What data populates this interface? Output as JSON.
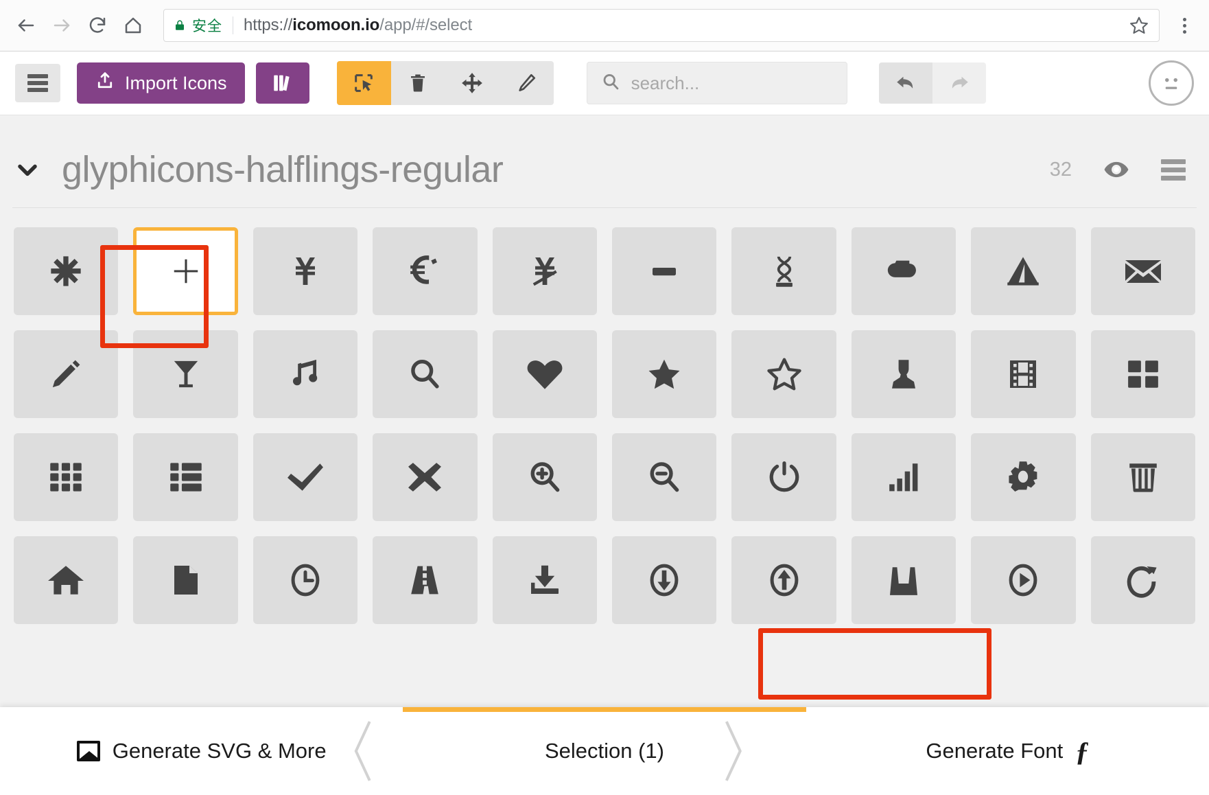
{
  "browser": {
    "security_label": "安全",
    "url_scheme": "https://",
    "url_host": "icomoon.io",
    "url_path": "/app/#/select",
    "icons": {
      "back": "back-arrow-icon",
      "forward": "forward-arrow-icon",
      "reload": "reload-icon",
      "home": "home-icon",
      "lock": "lock-icon",
      "bookmark": "star-icon",
      "menu": "three-dot-menu-icon"
    }
  },
  "toolbar": {
    "menu_label": "hamburger-menu",
    "import_label": "Import Icons",
    "library_label": "library",
    "tools": [
      {
        "name": "select-tool",
        "active": true
      },
      {
        "name": "delete-tool",
        "active": false
      },
      {
        "name": "move-tool",
        "active": false
      },
      {
        "name": "edit-tool",
        "active": false
      }
    ],
    "search_placeholder": "search...",
    "search_value": "",
    "undo_label": "undo",
    "redo_label": "redo",
    "avatar_label": "user-account"
  },
  "set": {
    "title": "glyphicons-halflings-regular",
    "count": "32",
    "collapsed": false
  },
  "grid": {
    "icons": [
      {
        "name": "asterisk-icon",
        "selected": false
      },
      {
        "name": "plus-icon",
        "selected": true
      },
      {
        "name": "yen-icon",
        "selected": false
      },
      {
        "name": "euro-icon",
        "selected": false
      },
      {
        "name": "ruble-icon",
        "selected": false
      },
      {
        "name": "minus-icon",
        "selected": false
      },
      {
        "name": "paperclip-icon",
        "selected": false
      },
      {
        "name": "cloud-icon",
        "selected": false
      },
      {
        "name": "tent-icon",
        "selected": false
      },
      {
        "name": "envelope-icon",
        "selected": false
      },
      {
        "name": "pencil-icon",
        "selected": false
      },
      {
        "name": "glass-icon",
        "selected": false
      },
      {
        "name": "music-icon",
        "selected": false
      },
      {
        "name": "search-icon",
        "selected": false
      },
      {
        "name": "heart-icon",
        "selected": false
      },
      {
        "name": "star-icon",
        "selected": false
      },
      {
        "name": "star-empty-icon",
        "selected": false
      },
      {
        "name": "user-icon",
        "selected": false
      },
      {
        "name": "film-icon",
        "selected": false
      },
      {
        "name": "th-large-icon",
        "selected": false
      },
      {
        "name": "th-grid-icon",
        "selected": false
      },
      {
        "name": "th-list-icon",
        "selected": false
      },
      {
        "name": "check-icon",
        "selected": false
      },
      {
        "name": "remove-icon",
        "selected": false
      },
      {
        "name": "zoom-in-icon",
        "selected": false
      },
      {
        "name": "zoom-out-icon",
        "selected": false
      },
      {
        "name": "power-off-icon",
        "selected": false
      },
      {
        "name": "signal-icon",
        "selected": false
      },
      {
        "name": "cog-icon",
        "selected": false
      },
      {
        "name": "trash-icon",
        "selected": false
      },
      {
        "name": "home-icon",
        "selected": false
      },
      {
        "name": "file-icon",
        "selected": false
      },
      {
        "name": "time-icon",
        "selected": false
      },
      {
        "name": "road-icon",
        "selected": false
      },
      {
        "name": "download-alt-icon",
        "selected": false
      },
      {
        "name": "download-icon",
        "selected": false
      },
      {
        "name": "upload-icon",
        "selected": false
      },
      {
        "name": "inbox-icon",
        "selected": false
      },
      {
        "name": "play-circle-icon",
        "selected": false
      },
      {
        "name": "refresh-icon",
        "selected": false
      }
    ]
  },
  "bottom_bar": {
    "generate_svg_label": "Generate SVG & More",
    "selection_label": "Selection (1)",
    "generate_font_label": "Generate Font"
  },
  "colors": {
    "brand_purple": "#834187",
    "accent_orange": "#f9b33b",
    "annotation_red": "#e8330e",
    "secure_green": "#0b8043"
  }
}
